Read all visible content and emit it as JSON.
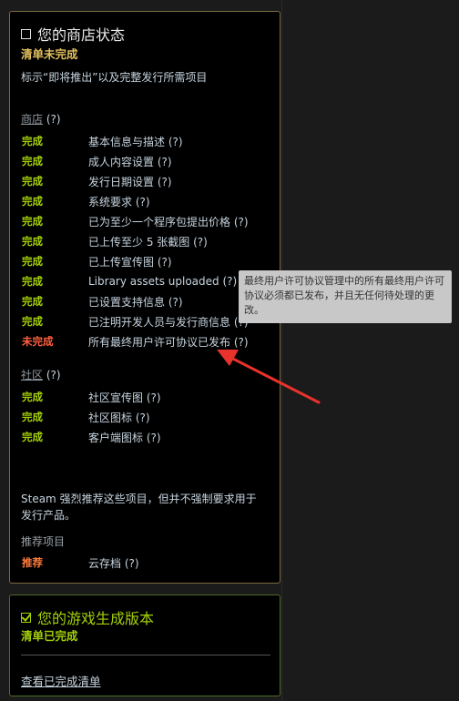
{
  "store": {
    "title": "您的商店状态",
    "status": "清单未完成",
    "description": "标示“即将推出”以及完整发行所需项目",
    "section_store_label": "商店",
    "section_community_label": "社区",
    "help": "(?)",
    "store_items": [
      {
        "state": "完成",
        "label": "基本信息与描述 (?)"
      },
      {
        "state": "完成",
        "label": "成人内容设置 (?)"
      },
      {
        "state": "完成",
        "label": "发行日期设置 (?)"
      },
      {
        "state": "完成",
        "label": "系统要求 (?)"
      },
      {
        "state": "完成",
        "label": "已为至少一个程序包提出价格 (?)"
      },
      {
        "state": "完成",
        "label": "已上传至少 5 张截图 (?)"
      },
      {
        "state": "完成",
        "label": "已上传宣传图 (?)"
      },
      {
        "state": "完成",
        "label": "Library assets uploaded (?)"
      },
      {
        "state": "完成",
        "label": "已设置支持信息 (?)"
      },
      {
        "state": "完成",
        "label": "已注明开发人员与发行商信息 (?)"
      },
      {
        "state": "未完成",
        "label": "所有最终用户许可协议已发布 (?)"
      }
    ],
    "community_items": [
      {
        "state": "完成",
        "label": "社区宣传图 (?)"
      },
      {
        "state": "完成",
        "label": "社区图标 (?)"
      },
      {
        "state": "完成",
        "label": "客户端图标 (?)"
      }
    ],
    "recommend_text": "Steam 强烈推荐这些项目，但并不强制要求用于发行产品。",
    "recommend_label": "推荐项目",
    "recommend_items": [
      {
        "state": "推荐",
        "label": "云存档 (?)"
      }
    ]
  },
  "build": {
    "title": "您的游戏生成版本",
    "status": "清单已完成",
    "link": "查看已完成清单"
  },
  "tooltip": {
    "text": "最终用户许可协议管理中的所有最终用户许可协议必须都已发布，并且无任何待处理的更改。"
  },
  "colors": {
    "complete": "#a4d007",
    "incomplete": "#ff5f3f",
    "recommended": "#ff7a3a",
    "gold": "#e2c15f",
    "arrow": "#e8322c"
  }
}
